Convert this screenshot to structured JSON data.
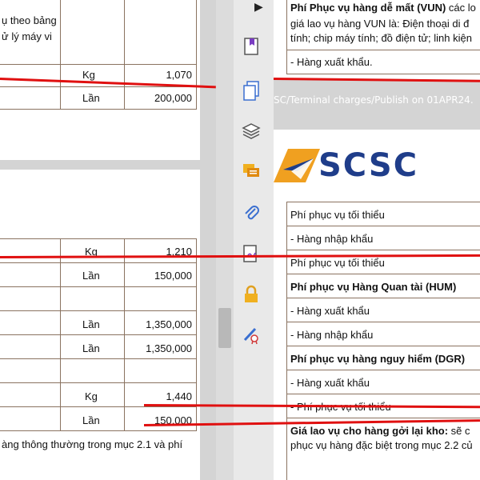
{
  "left_doc": {
    "page1": {
      "text_line1": "ụ theo bảng",
      "text_line2": "ử lý máy vi",
      "rows": [
        {
          "unit": "Kg",
          "value": "1,070"
        },
        {
          "unit": "Lần",
          "value": "200,000"
        }
      ]
    },
    "page2": {
      "rows": [
        {
          "unit": "Kg",
          "value": "1,210"
        },
        {
          "unit": "Lần",
          "value": "150,000"
        },
        {
          "unit": "Lần",
          "value": "1,350,000"
        },
        {
          "unit": "Lần",
          "value": "1,350,000"
        },
        {
          "unit": "Kg",
          "value": "1,440"
        },
        {
          "unit": "Lần",
          "value": "150,000"
        }
      ],
      "footer_text": "àng thông thường trong mục 2.1 và phí"
    }
  },
  "toolbar": {
    "tools": [
      "bookmark-icon",
      "pages-icon",
      "layers-icon",
      "comment-icon",
      "attachment-icon",
      "signature-icon",
      "lock-icon",
      "certificate-icon"
    ]
  },
  "right_doc": {
    "page1": {
      "heading": "Phí Phục vụ hàng dễ mất (VUN)",
      "heading_tail": " các lo",
      "line2": "giá lao vụ hàng VUN là: Điện thoại di đ",
      "line3": "tính; chip máy tính; đồ điện tử; linh kiện",
      "export_row": "- Hàng xuất khẩu."
    },
    "header_text": "SC/Terminal charges/Publish on 01APR24.",
    "logo_text": "SCSC",
    "page2": {
      "rows": [
        {
          "text": "Phí phục vụ tối thiểu",
          "bold": false
        },
        {
          "text": "- Hàng nhập khẩu",
          "bold": false
        },
        {
          "text": "Phí phục vụ tối thiểu",
          "bold": false
        },
        {
          "text": "Phí phục vụ Hàng Quan tài (HUM)",
          "bold": true
        },
        {
          "text": "- Hàng xuất khẩu",
          "bold": false
        },
        {
          "text": "- Hàng nhập khẩu",
          "bold": false
        },
        {
          "text": "Phí phục vụ hàng nguy hiểm (DGR)",
          "bold": true
        },
        {
          "text": "- Hàng xuất khẩu",
          "bold": false
        },
        {
          "text": "- Phí phục vụ tối thiểu",
          "bold": false
        }
      ],
      "storage_heading": "Giá lao vụ cho hàng gởi lại kho:",
      "storage_tail": " sẽ c",
      "storage_line2": "phục vụ hàng đặc biệt trong mục 2.2 củ"
    }
  },
  "colors": {
    "annotation": "#e01010",
    "logo_blue": "#1f3d8a",
    "logo_orange": "#f0a020"
  }
}
